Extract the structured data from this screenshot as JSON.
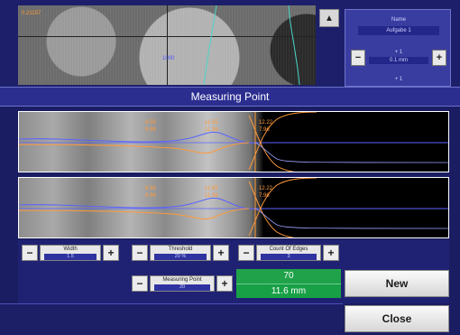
{
  "camera": {
    "readout": "0.21157",
    "center_label": "1000"
  },
  "side_panel": {
    "name_label": "Name",
    "name_value": "Aufgabe 1",
    "step_label": "+ 1",
    "step_value": "0.1 mm",
    "row2_label": "+ 1",
    "minus_label": "−",
    "plus_label": "+"
  },
  "title": "Measuring Point",
  "plots": [
    {
      "labels_left": [
        "8.56",
        "8.96"
      ],
      "labels_mid": [
        "11.55",
        "11.36"
      ],
      "labels_right": [
        "12.22",
        "7.96"
      ]
    },
    {
      "labels_left": [
        "8.56",
        "8.96"
      ],
      "labels_mid": [
        "11.55",
        "11.36"
      ],
      "labels_right": [
        "12.22",
        "7.96"
      ]
    }
  ],
  "controls": {
    "width": {
      "label": "Width",
      "value": "1.5"
    },
    "threshold": {
      "label": "Threshold",
      "value": "20 %"
    },
    "count_of_edges": {
      "label": "Count Of Edges",
      "value": "3"
    },
    "measuring_point": {
      "label": "Measuring Point",
      "value": "20"
    },
    "minus": "−",
    "plus": "+"
  },
  "readout": {
    "count": "70",
    "distance": "11.6 mm"
  },
  "buttons": {
    "new": "New",
    "close": "Close"
  },
  "colors": {
    "panel_bg": "#1b1d63",
    "title_bar": "#2b2e8f",
    "readout_green": "#1fa24a",
    "curve_orange": "#ff9a3c",
    "curve_blue": "#5a63ff",
    "edge_teal": "#4ad6c8"
  }
}
